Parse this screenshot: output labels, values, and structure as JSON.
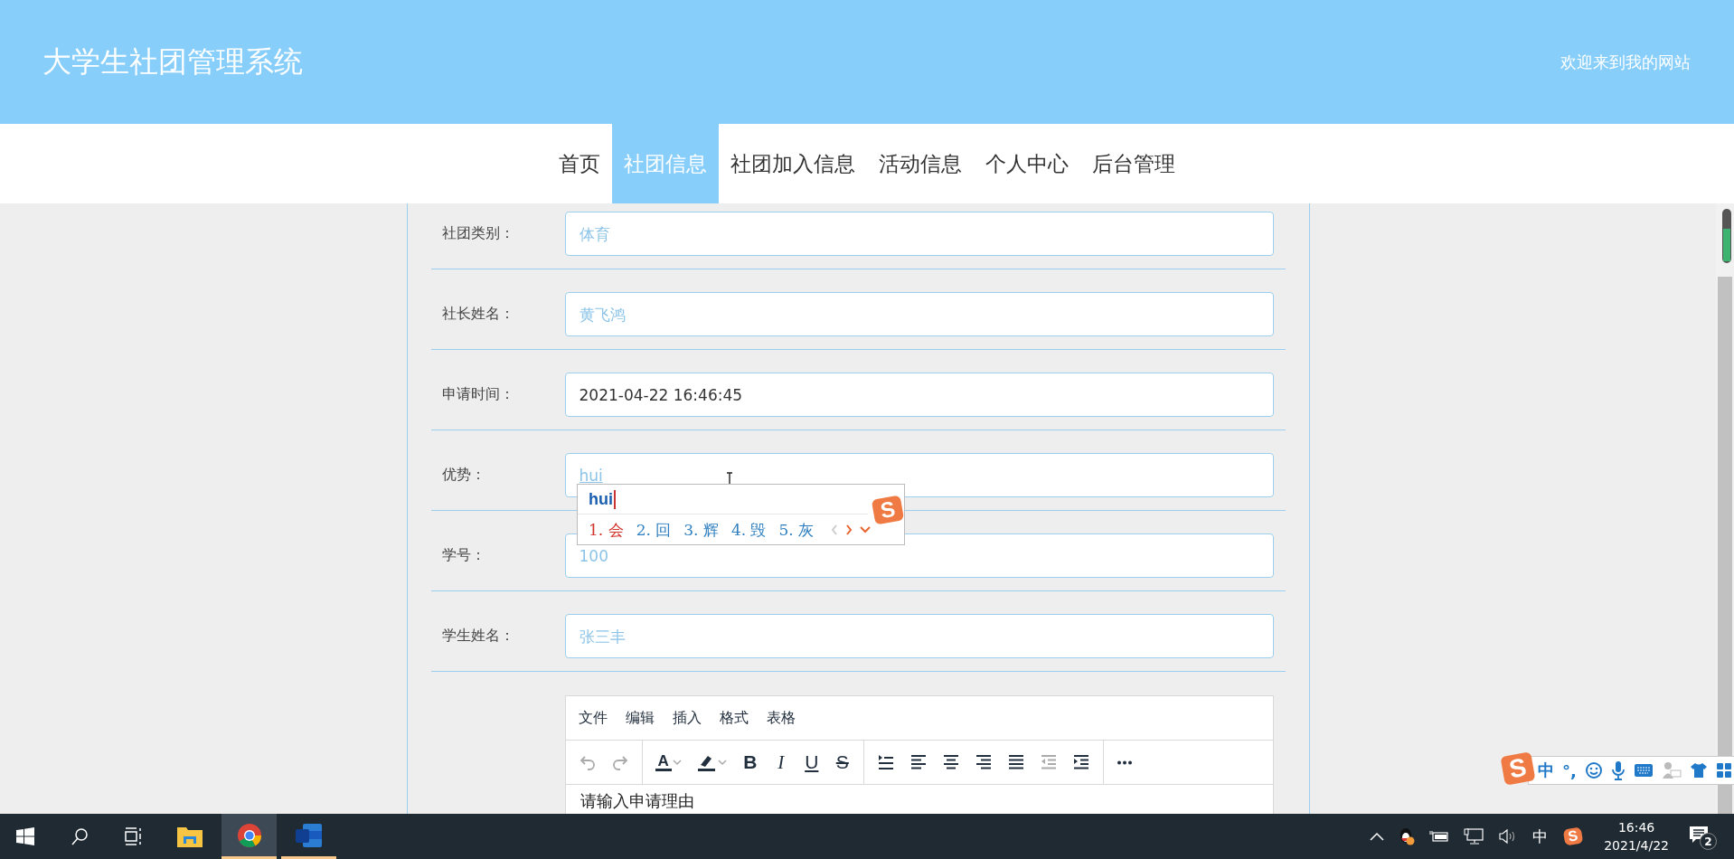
{
  "header": {
    "title": "大学生社团管理系统",
    "welcome": "欢迎来到我的网站"
  },
  "nav": [
    {
      "label": "首页",
      "selected": false
    },
    {
      "label": "社团信息",
      "selected": true
    },
    {
      "label": "社团加入信息",
      "selected": false
    },
    {
      "label": "活动信息",
      "selected": false
    },
    {
      "label": "个人中心",
      "selected": false
    },
    {
      "label": "后台管理",
      "selected": false
    }
  ],
  "form": {
    "fields": [
      {
        "label": "社团类别：",
        "placeholder": "体育"
      },
      {
        "label": "社长姓名：",
        "placeholder": "黄飞鸿"
      },
      {
        "label": "申请时间：",
        "value": "2021-04-22 16:46:45"
      },
      {
        "label": "优势：",
        "value": "hui",
        "composing": true
      },
      {
        "label": "学号：",
        "placeholder": "100"
      },
      {
        "label": "学生姓名：",
        "placeholder": "张三丰"
      }
    ],
    "editor": {
      "menu": [
        "文件",
        "编辑",
        "插入",
        "格式",
        "表格"
      ],
      "toolbar": [
        [
          {
            "kind": "undo",
            "disabled": true
          },
          {
            "kind": "redo",
            "disabled": true
          }
        ],
        [
          {
            "kind": "font-color",
            "glyph": "A",
            "disabled": false
          },
          {
            "kind": "highlight",
            "disabled": false
          },
          {
            "kind": "bold",
            "glyph": "B",
            "disabled": false
          },
          {
            "kind": "italic",
            "glyph": "I",
            "disabled": false
          },
          {
            "kind": "underline",
            "glyph": "U",
            "disabled": false
          },
          {
            "kind": "strike",
            "glyph": "S",
            "disabled": false
          }
        ],
        [
          {
            "kind": "line-height",
            "disabled": false
          },
          {
            "kind": "align-left",
            "disabled": false
          },
          {
            "kind": "align-center",
            "disabled": false
          },
          {
            "kind": "align-right",
            "disabled": false
          },
          {
            "kind": "justify",
            "disabled": false
          },
          {
            "kind": "outdent",
            "disabled": true
          },
          {
            "kind": "indent",
            "disabled": false
          }
        ],
        [
          {
            "kind": "more",
            "disabled": false
          }
        ]
      ],
      "placeholder": "请输入申请理由"
    }
  },
  "ime": {
    "composition": "hui",
    "logo": "S",
    "prev_disabled": true,
    "candidates": [
      {
        "label": "1. 会",
        "selected": true
      },
      {
        "label": "2. 回",
        "selected": false
      },
      {
        "label": "3. 辉",
        "selected": false
      },
      {
        "label": "4. 毁",
        "selected": false
      },
      {
        "label": "5. 灰",
        "selected": false
      }
    ]
  },
  "ime_bar": {
    "logo": "S",
    "mode": "中",
    "punctuation": "°,"
  },
  "taskbar": {
    "apps": [
      {
        "kind": "explorer",
        "active": false,
        "running": false
      },
      {
        "kind": "chrome",
        "active": true,
        "running": true
      },
      {
        "kind": "word",
        "active": false,
        "running": true
      }
    ],
    "tray": {
      "language": "中",
      "logo": "S",
      "time": "16:46",
      "date": "2021/4/22",
      "notifications": "2"
    }
  }
}
